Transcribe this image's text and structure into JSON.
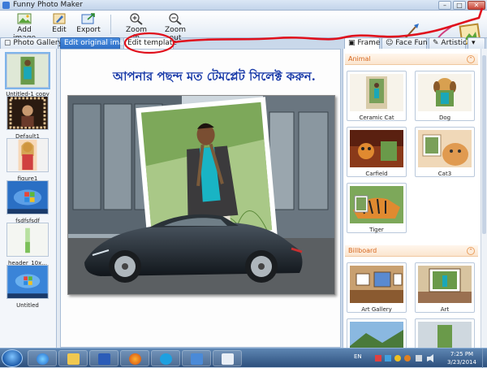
{
  "window": {
    "title": "Funny Photo Maker"
  },
  "toolbar": {
    "add_image": "Add image",
    "edit": "Edit",
    "export": "Export",
    "zoom_in": "Zoom in",
    "zoom_out": "Zoom out"
  },
  "tabs": {
    "gallery": "Photo Gallery",
    "edit_original": "Edit original image",
    "edit_template": "Edit template",
    "frame": "Frame",
    "face_fun": "Face Fun",
    "artistic": "Artistic"
  },
  "gallery": [
    {
      "label": "Untitled-1 copy"
    },
    {
      "label": "Default1"
    },
    {
      "label": "figure1"
    },
    {
      "label": "fsdfsfsdf"
    },
    {
      "label": "header_10x..."
    },
    {
      "label": "Untitled"
    }
  ],
  "canvas": {
    "heading": "আপনার পছন্দ মত টেমপ্লেট সিলেক্ট করুন."
  },
  "templates": {
    "animal_section": "Animal",
    "animal": [
      {
        "label": "Ceramic Cat"
      },
      {
        "label": "Dog"
      },
      {
        "label": "Carfield"
      },
      {
        "label": "Cat3"
      },
      {
        "label": "Tiger"
      }
    ],
    "billboard_section": "Billboard",
    "billboard": [
      {
        "label": "Art Gallery"
      },
      {
        "label": "Art"
      }
    ]
  },
  "taskbar": {
    "language": "EN",
    "time": "7:25 PM",
    "date": "3/23/2014"
  },
  "colors": {
    "annotation": "#e0101c",
    "heading": "#1638a8",
    "section_header": "#d6661d",
    "active_tab": "#2e6fc6"
  }
}
